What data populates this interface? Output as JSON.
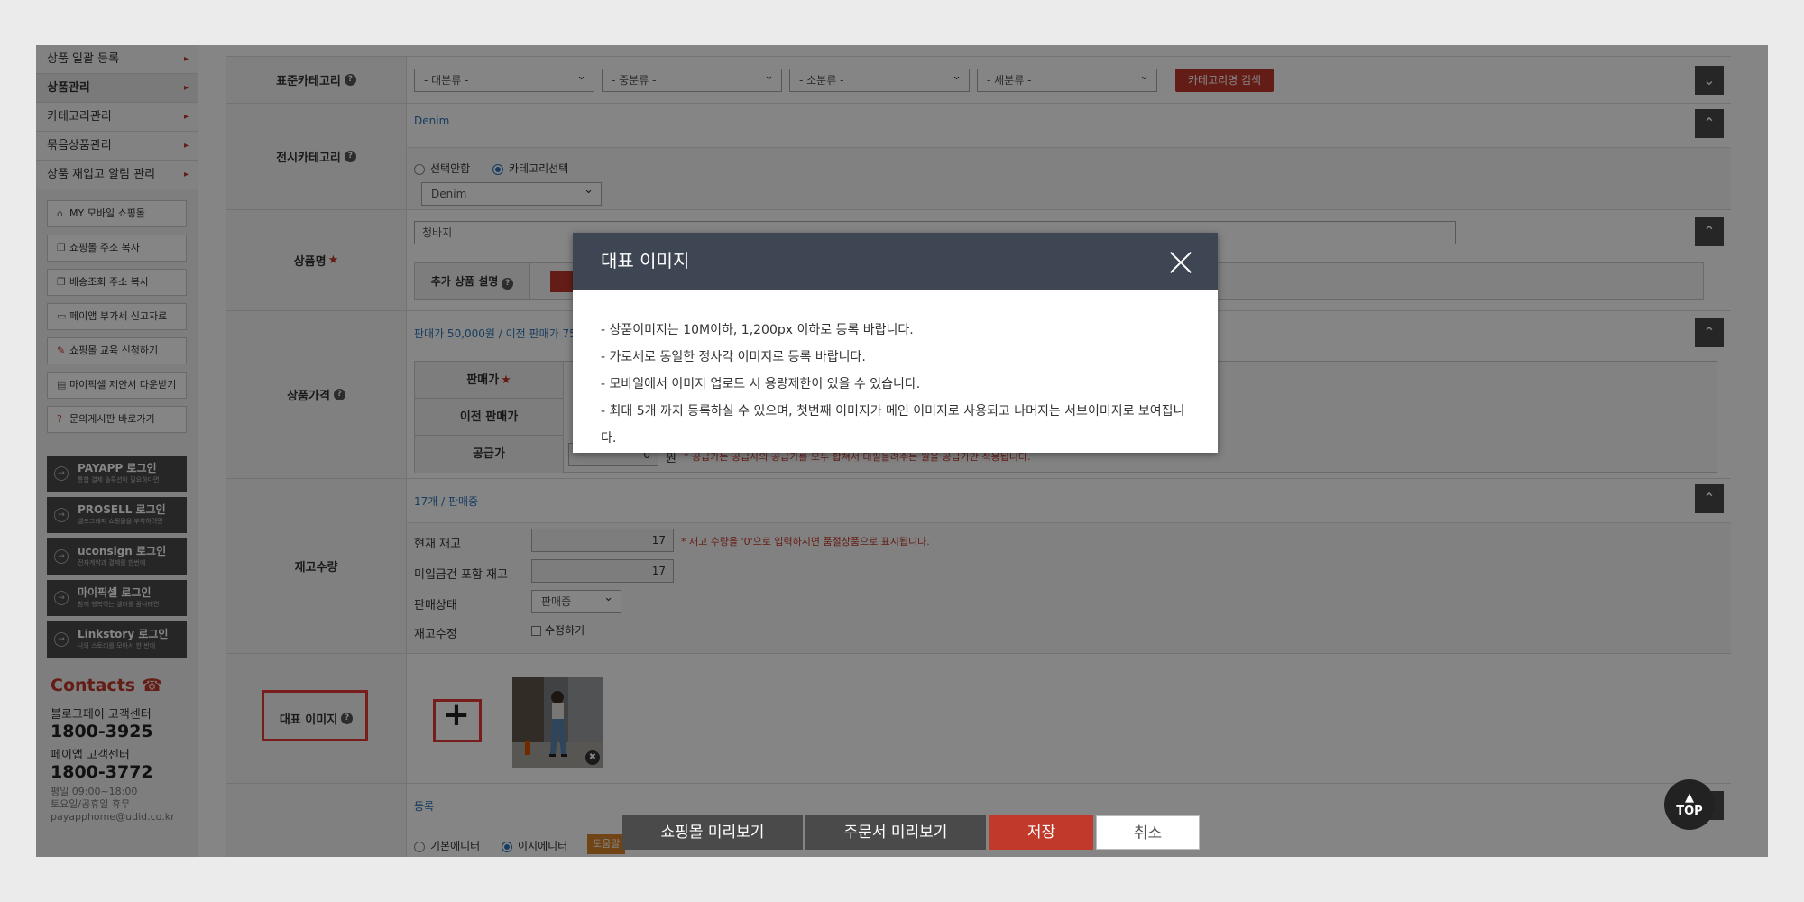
{
  "sidebar": {
    "menu": [
      {
        "label": "상품 일괄 등록"
      },
      {
        "label": "상품관리"
      },
      {
        "label": "카테고리관리"
      },
      {
        "label": "묶음상품관리"
      },
      {
        "label": "상품 재입고 알림 관리"
      }
    ],
    "quick": [
      {
        "icon": "home-icon",
        "label": "MY 모바일 쇼핑몰"
      },
      {
        "icon": "copy-icon",
        "label": "쇼핑몰 주소 복사"
      },
      {
        "icon": "copy-icon",
        "label": "배송조회 주소 복사"
      },
      {
        "icon": "folder-icon",
        "label": "페이앱 부가세 신고자료"
      },
      {
        "icon": "edit-icon",
        "label": "쇼핑몰 교육 신청하기"
      },
      {
        "icon": "document-icon",
        "label": "마이픽셀 제안서 다운받기"
      },
      {
        "icon": "question-icon",
        "label": "문의게시판 바로가기"
      }
    ],
    "logins": [
      {
        "title": "PAYAPP 로그인",
        "sub": "통합 결제 솔루션이 필요하다면"
      },
      {
        "title": "PROSELL 로그인",
        "sub": "셀프그래퍼 쇼핑몰을 부착하려면"
      },
      {
        "title": "uconsign 로그인",
        "sub": "전자계약과 결제를 한번에"
      },
      {
        "title": "마이픽셀 로그인",
        "sub": "함께 행복하는 셀러를 꿈나래면"
      },
      {
        "title": "Linkstory 로그인",
        "sub": "나의 스토리를 모아서 한 번에"
      }
    ],
    "contacts": {
      "title": "Contacts",
      "label1": "블로그페이 고객센터",
      "phone1": "1800-3925",
      "label2": "페이앱 고객센터",
      "phone2": "1800-3772",
      "hours": "평일 09:00~18:00",
      "holiday": "토요일/공휴일 휴무",
      "email": "payapphome@udid.co.kr"
    }
  },
  "form": {
    "std_category": {
      "label": "표준카테고리",
      "selects": [
        "- 대분류 -",
        "- 중분류 -",
        "- 소분류 -",
        "- 세분류 -"
      ],
      "search_btn": "카테고리명 검색"
    },
    "display_category": {
      "label": "전시카테고리",
      "summary": "Denim",
      "opt1": "선택안함",
      "opt2": "카테고리선택",
      "selected": "Denim"
    },
    "product_name": {
      "label": "상품명",
      "value": "청바지",
      "extra_label": "추가 상품 설명"
    },
    "price": {
      "label": "상품가격",
      "summary": "판매가 50,000원 / 이전 판매가 75",
      "rows": [
        "판매가",
        "이전 판매가",
        "공급가"
      ],
      "supply_value": "0",
      "supply_unit": "원",
      "supply_note": "* 공급가는 공급사의 공급가를 모두 합쳐서 대필돌려주는 월을 공급가만 적용됩니다."
    },
    "stock": {
      "label": "재고수량",
      "summary": "17개 / 판매중",
      "current_label": "현재 재고",
      "current_value": "17",
      "incl_label": "미입금건 포함 재고",
      "incl_value": "17",
      "status_label": "판매상태",
      "status_value": "판매중",
      "edit_label": "재고수정",
      "edit_checkbox": "수정하기",
      "note": "* 재고 수량을 '0'으로 입력하시면 품절상품으로 표시됩니다."
    },
    "main_image": {
      "label": "대표 이미지",
      "add": "+"
    },
    "register": {
      "summary": "등록",
      "opt1": "기본에디터",
      "opt2": "이지에디터",
      "help": "도움말"
    }
  },
  "modal": {
    "title": "대표 이미지",
    "lines": [
      "- 상품이미지는 10M이하, 1,200px 이하로 등록 바랍니다.",
      "- 가로세로 동일한 정사각 이미지로 등록 바랍니다.",
      "- 모바일에서 이미지 업로드 시 용량제한이 있을 수 있습니다.",
      "- 최대 5개 까지 등록하실 수 있으며, 첫번째 이미지가 메인 이미지로 사용되고 나머지는 서브이미지로 보여집니다."
    ]
  },
  "bottom": {
    "preview_shop": "쇼핑몰 미리보기",
    "preview_order": "주문서 미리보기",
    "save": "저장",
    "cancel": "취소",
    "top": "TOP"
  },
  "colors": {
    "accent_red": "#c0392b",
    "link_blue": "#2c73b8",
    "modal_header": "#3d4652",
    "highlight": "#e53935"
  }
}
